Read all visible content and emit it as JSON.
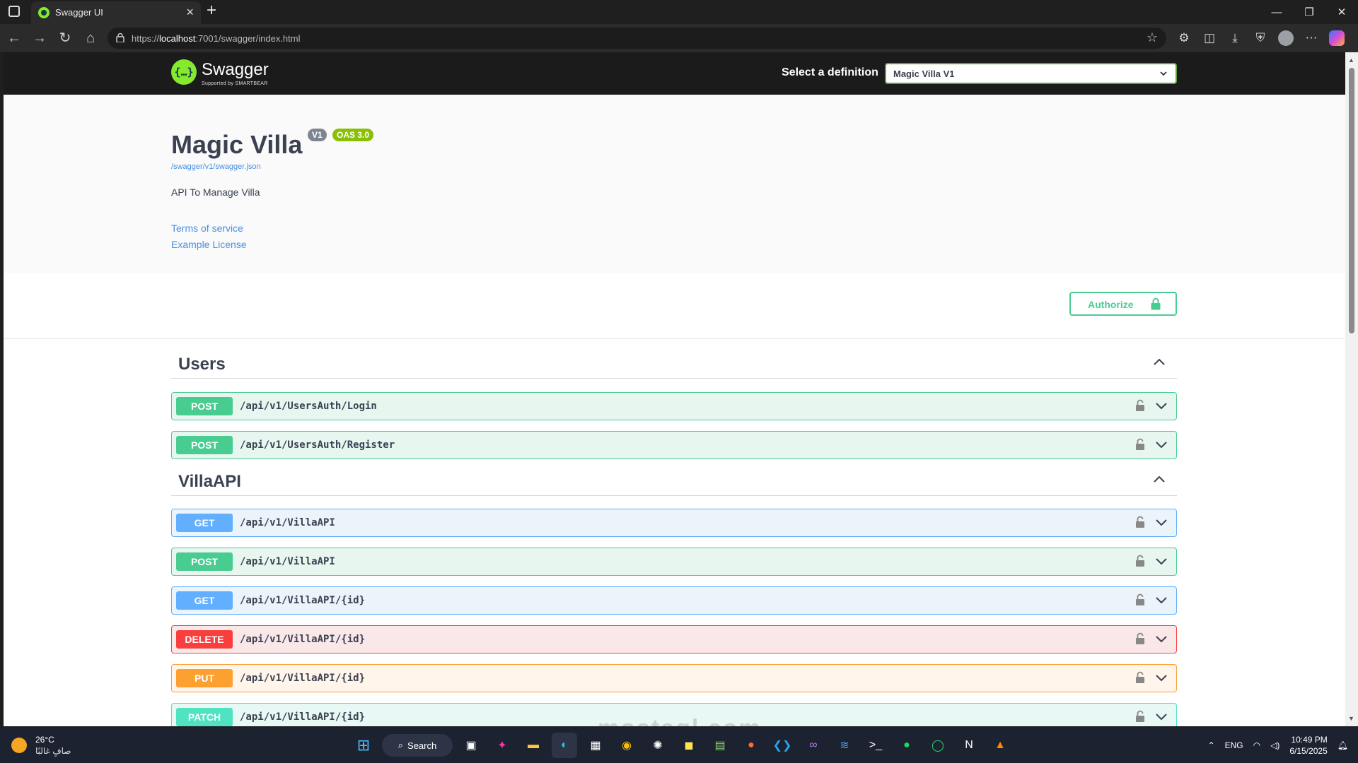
{
  "browser": {
    "tab_title": "Swagger UI",
    "url_prefix": "https://",
    "url_host": "localhost",
    "url_rest": ":7001/swagger/index.html"
  },
  "swagger": {
    "brand": "Swagger",
    "brand_sub": "Supported by SMARTBEAR",
    "select_label": "Select a definition",
    "select_value": "Magic Villa V1"
  },
  "info": {
    "title": "Magic Villa",
    "version_badge": "V1",
    "oas_badge": "OAS 3.0",
    "json_link": "/swagger/v1/swagger.json",
    "description": "API To Manage Villa",
    "terms": "Terms of service",
    "license": "Example License"
  },
  "auth": {
    "label": "Authorize"
  },
  "tags": [
    {
      "name": "Users",
      "operations": [
        {
          "method": "POST",
          "path": "/api/v1/UsersAuth/Login"
        },
        {
          "method": "POST",
          "path": "/api/v1/UsersAuth/Register"
        }
      ]
    },
    {
      "name": "VillaAPI",
      "operations": [
        {
          "method": "GET",
          "path": "/api/v1/VillaAPI"
        },
        {
          "method": "POST",
          "path": "/api/v1/VillaAPI"
        },
        {
          "method": "GET",
          "path": "/api/v1/VillaAPI/{id}"
        },
        {
          "method": "DELETE",
          "path": "/api/v1/VillaAPI/{id}"
        },
        {
          "method": "PUT",
          "path": "/api/v1/VillaAPI/{id}"
        },
        {
          "method": "PATCH",
          "path": "/api/v1/VillaAPI/{id}"
        }
      ]
    }
  ],
  "colors": {
    "post": "#49cc90",
    "get": "#61affe",
    "delete": "#f93e3e",
    "put": "#fca130",
    "patch": "#50e3c2"
  },
  "watermark": "mostaql.com",
  "taskbar": {
    "temp": "26°C",
    "weather": "صافٍ غالبًا",
    "search": "Search",
    "lang": "ENG",
    "time": "10:49 PM",
    "date": "6/15/2025"
  }
}
